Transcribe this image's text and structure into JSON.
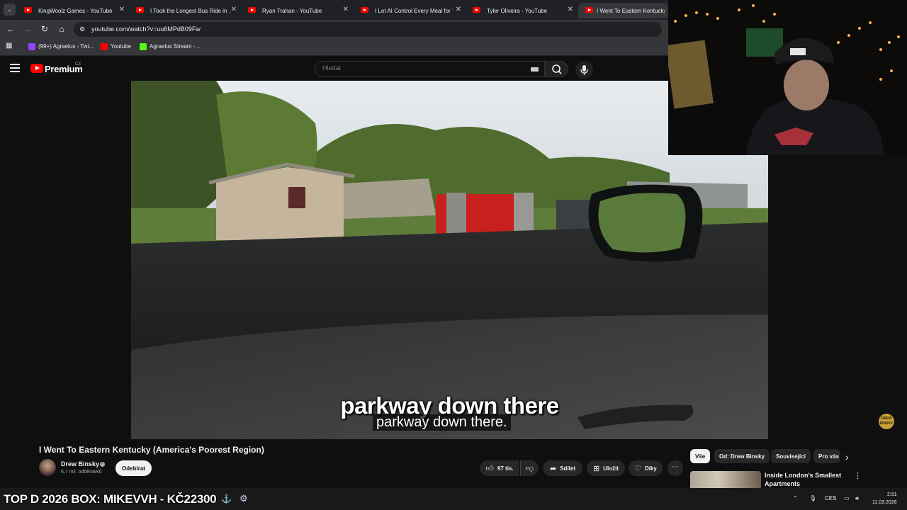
{
  "browser": {
    "tabs": [
      {
        "title": "KingWoolz Games - YouTube"
      },
      {
        "title": "I Took the Longest Bus Ride in ..."
      },
      {
        "title": "Ryan Trahan - YouTube"
      },
      {
        "title": "I Let AI Control Every Meal for 7..."
      },
      {
        "title": "Tyler Oliveira - YouTube"
      },
      {
        "title": "I Went To Eastern Kentucky"
      }
    ],
    "url": "youtube.com/watch?v=uu6MPdB09Fw",
    "bookmarks": [
      {
        "label": "(99+) Agraelus - Twi...",
        "icon_color": "#9146ff"
      },
      {
        "label": "Youtube",
        "icon_color": "#ff0000"
      },
      {
        "label": "Agraelus Stream -...",
        "icon_color": "#53fc18"
      }
    ]
  },
  "youtube": {
    "brand": "Premium",
    "country": "CZ",
    "search_placeholder": "Hledat"
  },
  "video": {
    "subtitle_burned": "parkway down there",
    "subtitle_cc": "parkway down there.",
    "watermark": "DREW BINSKY",
    "title": "I Went To Eastern Kentucky (America's Poorest Region)"
  },
  "channel": {
    "name": "Drew Binsky",
    "subscribers": "6,7 mil. odběratelů",
    "subscribe_label": "Odebírat"
  },
  "actions": {
    "likes": "97 tis.",
    "share": "Sdílet",
    "save": "Uložit",
    "thanks": "Díky"
  },
  "chips": [
    "Vše",
    "Od: Drew Binsky",
    "Související",
    "Pro vás"
  ],
  "recommendation": {
    "title": "Inside London's Smallest Apartments"
  },
  "taskbar": {
    "overlay_text": "TOP D 2026 BOX: MIKEVVH - KČ22300",
    "language": "CES",
    "time": "2:51",
    "date": "11.03.2026"
  }
}
